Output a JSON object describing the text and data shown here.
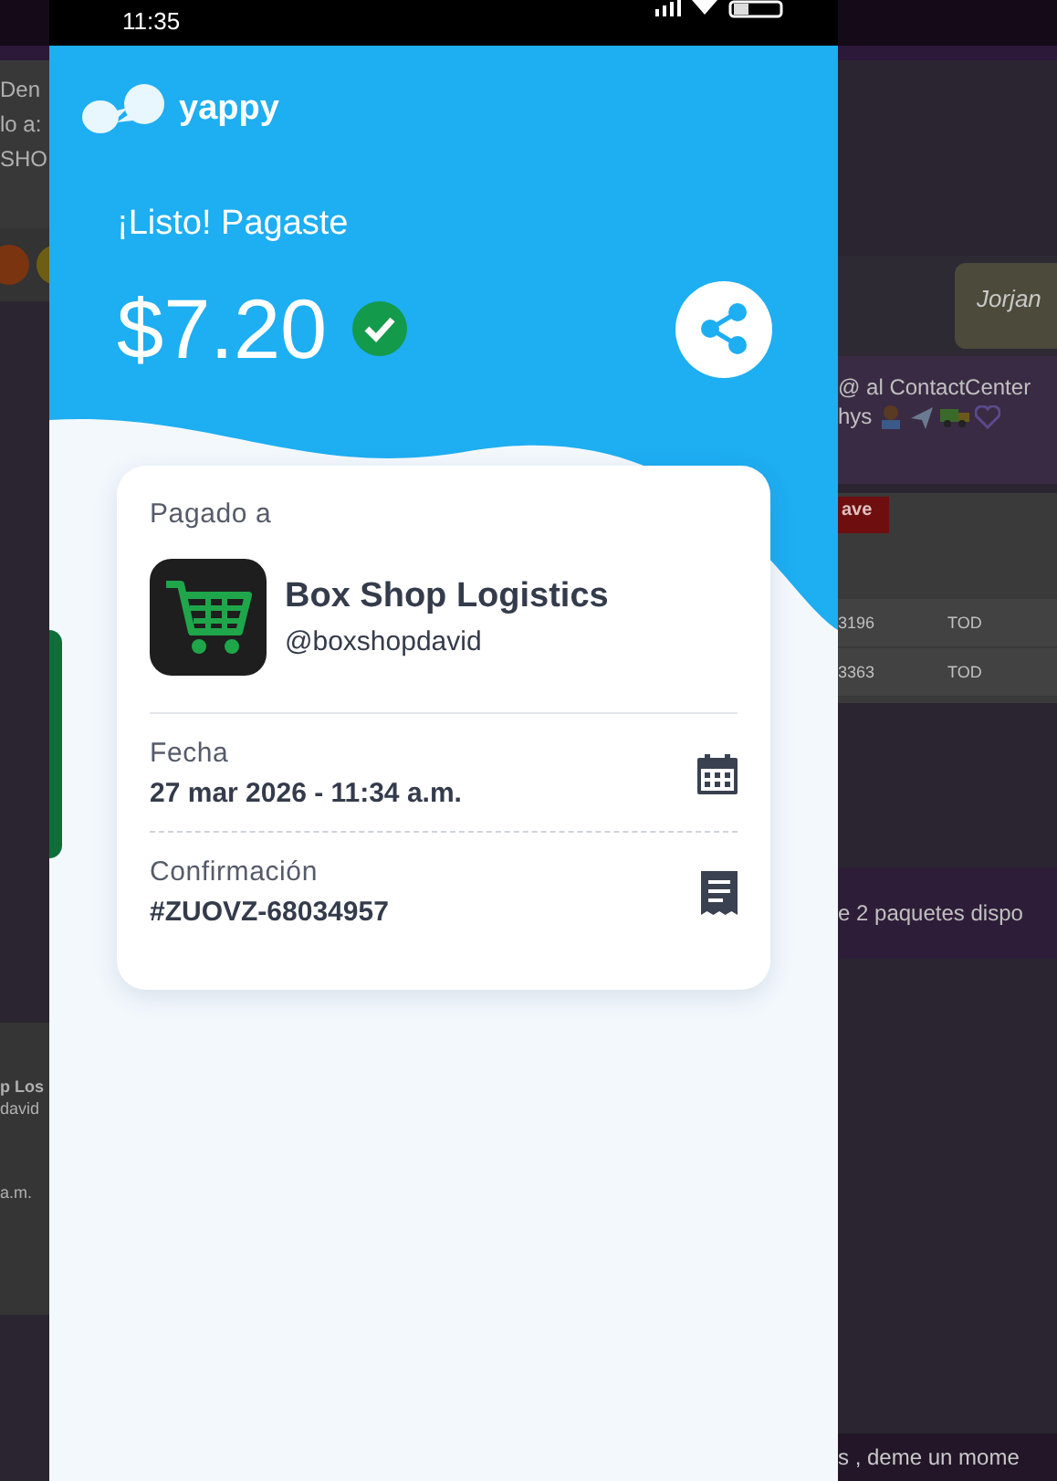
{
  "status_bar": {
    "time": "11:35"
  },
  "app": {
    "logo": "yappy",
    "title": "¡Listo! Pagaste",
    "amount": "$7.20",
    "confirmed": true,
    "card": {
      "paid_to_label": "Pagado a",
      "merchant": {
        "name": "Box Shop Logistics",
        "handle": "@boxshopdavid"
      },
      "details": [
        {
          "kind": "date",
          "label": "Fecha",
          "value": "27 mar 2026 - 11:34 a.m."
        },
        {
          "kind": "receipt",
          "label": "Confirmación",
          "value": "#ZUOVZ-68034957"
        }
      ]
    }
  },
  "background_left": {
    "header_lines": [
      "Den",
      "lo a:",
      "SHO"
    ],
    "contact": {
      "name": "p Los",
      "handle": "david",
      "time": "a.m."
    }
  },
  "background_right": {
    "bubble": "Jorjan",
    "message": "@ al ContactCenter",
    "message_2": "hys",
    "tag": "ave",
    "rows": [
      [
        "3196",
        "TOD"
      ],
      [
        "3363",
        "TOD"
      ]
    ],
    "banner": "e 2 paquetes dispo",
    "footer": "s , deme un mome"
  }
}
